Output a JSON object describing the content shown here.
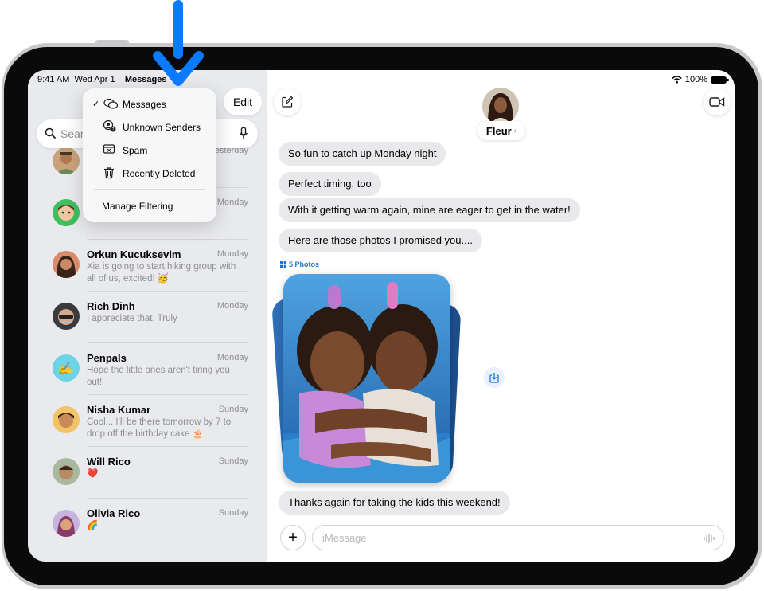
{
  "status_bar": {
    "time": "9:41 AM",
    "date": "Wed Apr 1",
    "battery": "100%"
  },
  "sidebar": {
    "title": "Messages",
    "edit_label": "Edit",
    "search_placeholder": "Search",
    "filter_menu": {
      "items": [
        {
          "label": "Messages",
          "icon": "bubbles-icon",
          "checked": true
        },
        {
          "label": "Unknown Senders",
          "icon": "person-question-icon"
        },
        {
          "label": "Spam",
          "icon": "junk-tray-icon"
        },
        {
          "label": "Recently Deleted",
          "icon": "trash-icon"
        }
      ],
      "manage_label": "Manage Filtering"
    },
    "conversations": [
      {
        "name": "",
        "time": "Yesterday",
        "preview": "",
        "avatar": "man-smiling-avatar"
      },
      {
        "name": "",
        "time": "Monday",
        "preview": "",
        "avatar": "memoji-green-avatar"
      },
      {
        "name": "Orkun Kucuksevim",
        "time": "Monday",
        "preview": "Xia is going to start hiking group with all of us, excited! 🥳",
        "avatar": "woman-photo-avatar"
      },
      {
        "name": "Rich Dinh",
        "time": "Monday",
        "preview": "I appreciate that. Truly",
        "avatar": "memoji-sunglasses-avatar"
      },
      {
        "name": "Penpals",
        "time": "Monday",
        "preview": "Hope the little ones aren't tiring you out!",
        "avatar": "writing-hand-avatar"
      },
      {
        "name": "Nisha Kumar",
        "time": "Sunday",
        "preview": "Cool... I'll be there tomorrow by 7 to drop off the birthday cake 🎂",
        "avatar": "memoji-nisha-avatar"
      },
      {
        "name": "Will Rico",
        "time": "Sunday",
        "preview": "❤️",
        "avatar": "memoji-will-avatar"
      },
      {
        "name": "Olivia Rico",
        "time": "Sunday",
        "preview": "🌈",
        "avatar": "memoji-olivia-avatar"
      }
    ]
  },
  "conversation": {
    "contact_name": "Fleur",
    "messages": [
      "So fun to catch up Monday night",
      "Perfect timing, too",
      "With it getting warm again, mine are eager to get in the water!",
      "Here are those photos I promised you...."
    ],
    "photos_label": "5 Photos",
    "last_message": "Thanks again for taking the kids this weekend!",
    "input_placeholder": "iMessage"
  },
  "colors": {
    "accent": "#1a74d6",
    "callout_arrow": "#0a7aff",
    "sidebar_bg": "#e9eaee",
    "bubble_bg": "#e9e9eb"
  }
}
